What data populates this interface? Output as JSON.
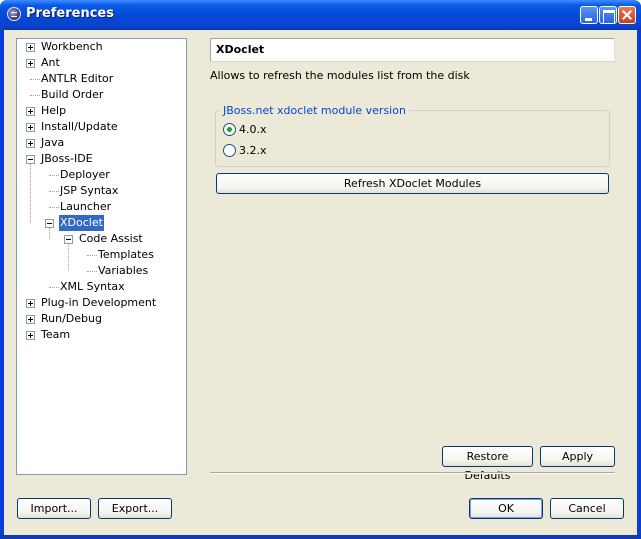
{
  "window": {
    "title": "Preferences",
    "icon": "eclipse-icon"
  },
  "tree": {
    "items": [
      {
        "label": "Workbench",
        "expander": "plus"
      },
      {
        "label": "Ant",
        "expander": "plus"
      },
      {
        "label": "ANTLR Editor",
        "expander": "none"
      },
      {
        "label": "Build Order",
        "expander": "none"
      },
      {
        "label": "Help",
        "expander": "plus"
      },
      {
        "label": "Install/Update",
        "expander": "plus"
      },
      {
        "label": "Java",
        "expander": "plus"
      },
      {
        "label": "JBoss-IDE",
        "expander": "minus"
      },
      {
        "label": "Deployer",
        "expander": "none"
      },
      {
        "label": "JSP Syntax",
        "expander": "none"
      },
      {
        "label": "Launcher",
        "expander": "none"
      },
      {
        "label": "XDoclet",
        "expander": "minus",
        "selected": true
      },
      {
        "label": "Code Assist",
        "expander": "minus"
      },
      {
        "label": "Templates",
        "expander": "none"
      },
      {
        "label": "Variables",
        "expander": "none"
      },
      {
        "label": "XML Syntax",
        "expander": "none"
      },
      {
        "label": "Plug-in Development",
        "expander": "plus"
      },
      {
        "label": "Run/Debug",
        "expander": "plus"
      },
      {
        "label": "Team",
        "expander": "plus"
      }
    ]
  },
  "page": {
    "title": "XDoclet",
    "description": "Allows to refresh the modules list from the disk",
    "group_label": "JBoss.net xdoclet module version",
    "options": [
      {
        "label": "4.0.x",
        "checked": true
      },
      {
        "label": "3.2.x",
        "checked": false
      }
    ],
    "refresh_button": "Refresh XDoclet Modules",
    "restore_defaults": "Restore Defaults",
    "apply": "Apply"
  },
  "footer": {
    "import": "Import...",
    "export": "Export...",
    "ok": "OK",
    "cancel": "Cancel"
  },
  "colors": {
    "selection": "#316ac5",
    "dialog_bg": "#ece9d8",
    "group_label": "#0046d5"
  }
}
